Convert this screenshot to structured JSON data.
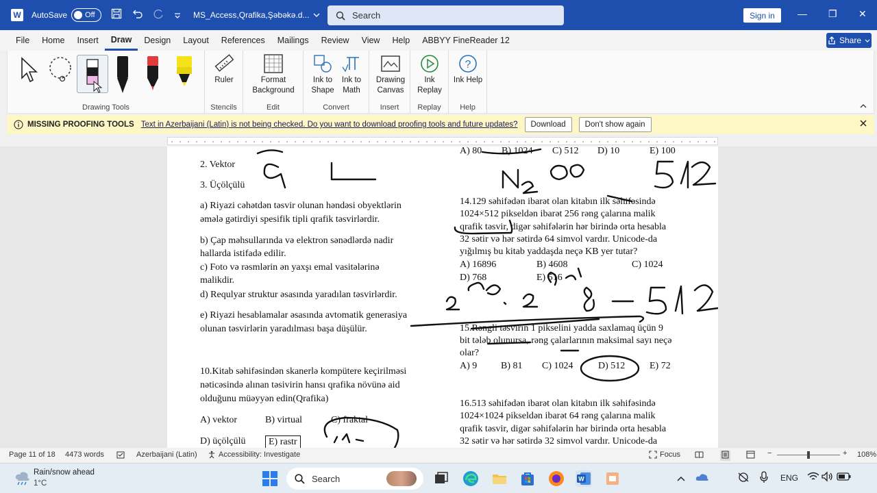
{
  "titlebar": {
    "app_icon": "W",
    "autosave_label": "AutoSave",
    "autosave_state": "Off",
    "doc_title": "MS_Access,Qrafika,Şəbəkə.d...",
    "search_placeholder": "Search",
    "signin_label": "Sign in",
    "minimize_icon": "—",
    "restore_icon": "❐",
    "close_icon": "✕"
  },
  "menu": {
    "tabs": [
      "File",
      "Home",
      "Insert",
      "Draw",
      "Design",
      "Layout",
      "References",
      "Mailings",
      "Review",
      "View",
      "Help",
      "ABBYY FineReader 12"
    ],
    "active_tab": "Draw",
    "share_label": "Share"
  },
  "ribbon": {
    "groups": {
      "drawing_tools": "Drawing Tools",
      "stencils": "Stencils",
      "edit": "Edit",
      "convert": "Convert",
      "insert": "Insert",
      "replay": "Replay",
      "help": "Help"
    },
    "buttons": {
      "ruler": "Ruler",
      "format_background": "Format Background",
      "ink_to_shape": "Ink to Shape",
      "ink_to_math": "Ink to Math",
      "drawing_canvas": "Drawing Canvas",
      "ink_replay": "Ink Replay",
      "ink_help": "Ink Help"
    },
    "pen_colors": [
      "#1a1a1a",
      "#1a1a1a",
      "#e23b3b",
      "#f5e31a"
    ]
  },
  "infobar": {
    "title": "MISSING PROOFING TOOLS",
    "message": "Text in Azerbaijani (Latin) is not being checked. Do you want to download proofing tools and future updates?",
    "download_label": "Download",
    "dont_show_label": "Don't show again"
  },
  "document": {
    "left": [
      "2. Vektor",
      "3. Üçölçülü",
      "a) Riyazi cəhətdən təsvir olunan həndəsi obyektlərin",
      "əmələ gətirdiyi spesifik tipli qrafik təsvirlərdir.",
      "b) Çap məhsullarında və elektron sənədlərdə nadir",
      "hallarda istifadə edilir.",
      "c) Foto və rəsmlərin ən yaxşı emal vasitələrinə",
      "malikdir.",
      "d) Requlyar struktur əsasında yaradılan təsvirlərdir.",
      "e) Riyazi hesablamalar əsasında avtomatik generasiya",
      "olunan təsvirlərin yaradılması başa düşülür.",
      "10.Kitab səhifəsindən skanerlə kompütere keçirilməsi",
      "nəticəsində alınan təsivirin hansı qrafika növünə aid",
      "olduğunu müəyyən edin(Qrafika)"
    ],
    "q10_options": [
      "A) vektor",
      "B) virtual",
      "C) fraktal",
      "D) üçölçülü",
      "E) rastr"
    ],
    "right_top_options": [
      "A) 80",
      "B) 1024",
      "C) 512",
      "D) 10",
      "E) 100"
    ],
    "q14": [
      "14.129 səhifədən ibarət olan kitabın ilk səhifəsində",
      "1024×512 pikseldən ibarət 256 rəng çalarına malik",
      "qrafik təsvir, digər səhifələrin hər birində orta hesabla",
      "32 sətir və hər sətirdə 64 simvol vardır. Unicode-da",
      "yığılmış bu kitab yaddaşda neçə KB yer tutar?"
    ],
    "q14_options": [
      "A) 16896",
      "B) 4608",
      "C) 1024",
      "D) 768",
      "E) 516"
    ],
    "q15": [
      "15.Rəngli təsvirin 1 pikselini yadda saxlamaq üçün 9",
      "bit tələb olunursa, rəng çalarlarının maksimal sayı neçə",
      "olar?"
    ],
    "q15_options": [
      "A) 9",
      "B) 81",
      "C) 1024",
      "D) 512",
      "E) 72"
    ],
    "q16": [
      "16.513 səhifədən ibarət olan kitabın ilk səhifəsində",
      "1024×1024 pikseldən ibarət 64 rəng çalarına malik",
      "qrafik təsvir, digər səhifələrin hər birində orta hesabla",
      "32 sətir və hər sətirdə 32 simvol vardır. Unicode-da"
    ]
  },
  "statusbar": {
    "page": "Page 11 of 18",
    "words": "4473 words",
    "language": "Azerbaijani (Latin)",
    "accessibility": "Accessibility: Investigate",
    "focus": "Focus",
    "zoom": "108%"
  },
  "taskbar": {
    "weather_title": "Rain/snow ahead",
    "weather_temp": "1°C",
    "search_label": "Search",
    "lang": "ENG"
  }
}
